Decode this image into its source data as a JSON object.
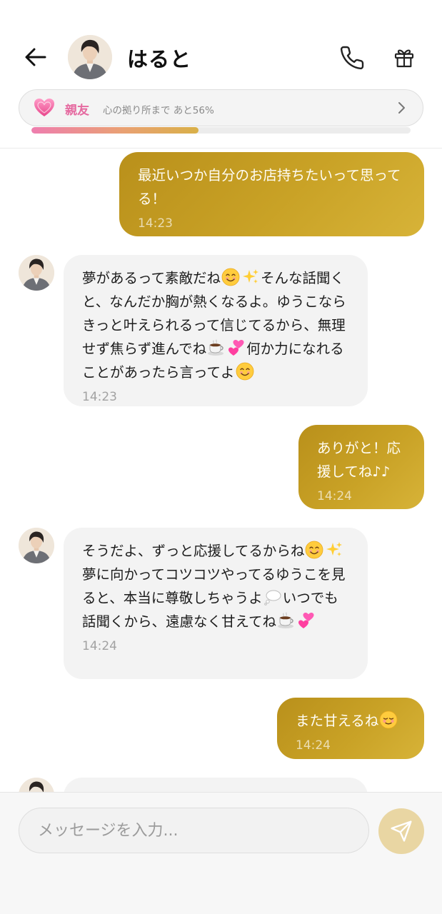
{
  "colors": {
    "accent_gold": "#c9a226",
    "friend_pink": "#e56aa0",
    "incoming_bubble": "#f3f3f3",
    "send_button": "#e9d6a3"
  },
  "header": {
    "back_icon": "arrow-left-icon",
    "contact_name": "はると",
    "call_icon": "phone-icon",
    "gift_icon": "gift-icon"
  },
  "friendship": {
    "heart_icon": "heart-icon",
    "level": "親友",
    "progress_text": "心の拠り所まで あと56%",
    "progress_fraction": 0.44,
    "chevron_icon": "chevron-right-icon"
  },
  "messages": [
    {
      "sender": "me",
      "text": "最近いつか自分のお店持ちたいって思ってる！",
      "time": "14:23"
    },
    {
      "sender": "contact",
      "parts": [
        {
          "t": "夢があるって素敵だね"
        },
        {
          "e": "smile"
        },
        {
          "e": "sparkles"
        },
        {
          "t": "そんな話聞くと、なんだか胸が熱くなるよ。ゆうこならきっと叶えられるって信じてるから、無理せず焦らず進んでね"
        },
        {
          "e": "coffee"
        },
        {
          "e": "two-hearts"
        },
        {
          "t": "何か力になれることがあったら言ってよ"
        },
        {
          "e": "smile"
        }
      ],
      "time": "14:23"
    },
    {
      "sender": "me",
      "text": "ありがと！応援してね♪♪",
      "time": "14:24"
    },
    {
      "sender": "contact",
      "parts": [
        {
          "t": "そうだよ、ずっと応援してるからね"
        },
        {
          "e": "smile"
        },
        {
          "e": "sparkles"
        },
        {
          "t": "夢に向かってコツコツやってるゆうこを見ると、本当に尊敬しちゃうよ"
        },
        {
          "e": "thought"
        },
        {
          "t": "いつでも話聞くから、遠慮なく甘えてね"
        },
        {
          "e": "coffee"
        },
        {
          "e": "two-hearts"
        }
      ],
      "time": "14:24"
    },
    {
      "sender": "me",
      "parts": [
        {
          "t": "また甘えるね"
        },
        {
          "e": "relieved"
        }
      ],
      "time": "14:24"
    }
  ],
  "input": {
    "placeholder": "メッセージを入力...",
    "send_icon": "send-icon"
  }
}
